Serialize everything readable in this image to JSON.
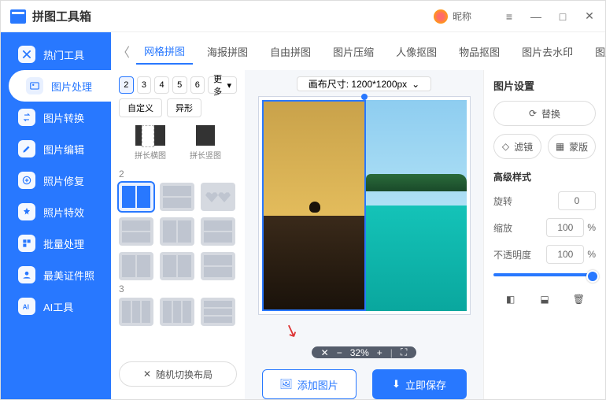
{
  "app": {
    "title": "拼图工具箱",
    "nickname": "昵称"
  },
  "win": {
    "menu": "≡",
    "min": "—",
    "max": "□",
    "close": "✕"
  },
  "sidebar": {
    "items": [
      {
        "label": "热门工具",
        "icon": "hot-icon",
        "fill": "#2878ff"
      },
      {
        "label": "图片处理",
        "icon": "image-icon",
        "fill": "#2878ff"
      },
      {
        "label": "图片转换",
        "icon": "convert-icon",
        "fill": "#2878ff"
      },
      {
        "label": "图片编辑",
        "icon": "edit-icon",
        "fill": "#2878ff"
      },
      {
        "label": "照片修复",
        "icon": "repair-icon",
        "fill": "#2878ff"
      },
      {
        "label": "照片特效",
        "icon": "effect-icon",
        "fill": "#2878ff"
      },
      {
        "label": "批量处理",
        "icon": "batch-icon",
        "fill": "#2878ff"
      },
      {
        "label": "最美证件照",
        "icon": "idphoto-icon",
        "fill": "#2878ff"
      },
      {
        "label": "AI工具",
        "icon": "ai-icon",
        "fill": "#2878ff"
      }
    ],
    "active": 1
  },
  "tabs": {
    "items": [
      "网格拼图",
      "海报拼图",
      "自由拼图",
      "图片压缩",
      "人像抠图",
      "物品抠图",
      "图片去水印",
      "图片加水"
    ],
    "active": 0
  },
  "layouts": {
    "counts": [
      "2",
      "3",
      "4",
      "5",
      "6"
    ],
    "more": "更多",
    "chips": [
      "自定义",
      "异形"
    ],
    "stitch_h": "拼长横图",
    "stitch_v": "拼长竖图",
    "sec1": "2",
    "sec2": "3",
    "shuffle": "随机切换布局"
  },
  "canvas": {
    "size_label": "画布尺寸: 1200*1200px",
    "zoom": "32%",
    "add_image": "添加图片",
    "save_now": "立即保存"
  },
  "right": {
    "title": "图片设置",
    "replace": "替换",
    "filter": "滤镜",
    "mask": "蒙版",
    "advanced": "高级样式",
    "rotate": "旋转",
    "rotate_val": "0",
    "scale": "缩放",
    "scale_val": "100",
    "pct": "%",
    "opacity": "不透明度",
    "opacity_val": "100"
  }
}
